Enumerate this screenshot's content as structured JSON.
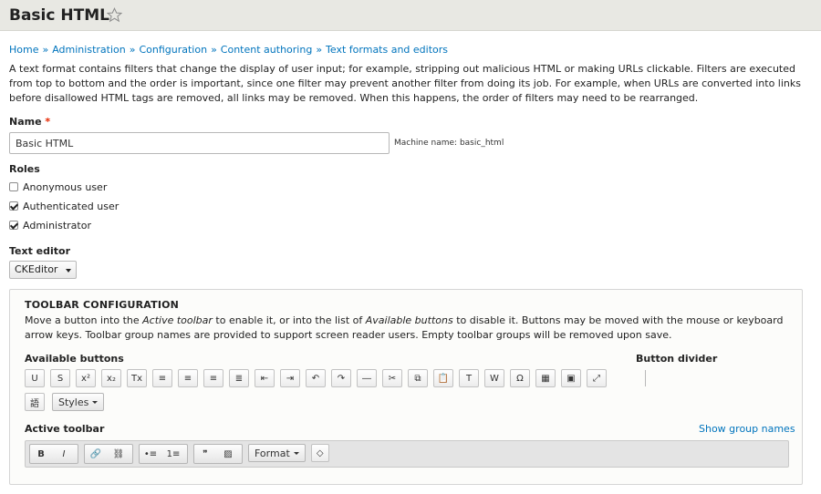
{
  "header": {
    "title": "Basic HTML",
    "star_icon": "star-outline-icon"
  },
  "breadcrumb": [
    "Home",
    "Administration",
    "Configuration",
    "Content authoring",
    "Text formats and editors"
  ],
  "breadcrumb_sep": "»",
  "description": "A text format contains filters that change the display of user input; for example, stripping out malicious HTML or making URLs clickable. Filters are executed from top to bottom and the order is important, since one filter may prevent another filter from doing its job. For example, when URLs are converted into links before disallowed HTML tags are removed, all links may be removed. When this happens, the order of filters may need to be rearranged.",
  "name": {
    "label": "Name",
    "required_mark": "*",
    "value": "Basic HTML",
    "machine_name": "Machine name: basic_html"
  },
  "roles": {
    "label": "Roles",
    "items": [
      {
        "label": "Anonymous user",
        "checked": false
      },
      {
        "label": "Authenticated user",
        "checked": true
      },
      {
        "label": "Administrator",
        "checked": true
      }
    ]
  },
  "text_editor": {
    "label": "Text editor",
    "value": "CKEditor"
  },
  "toolbar": {
    "title": "TOOLBAR CONFIGURATION",
    "description_prefix": "Move a button into the ",
    "description_em1": "Active toolbar",
    "description_mid": " to enable it, or into the list of ",
    "description_em2": "Available buttons",
    "description_suffix": " to disable it. Buttons may be moved with the mouse or keyboard arrow keys. Toolbar group names are provided to support screen reader users. Empty toolbar groups will be removed upon save.",
    "available_label": "Available buttons",
    "divider_label": "Button divider",
    "active_label": "Active toolbar",
    "show_group_names": "Show group names",
    "available_buttons": [
      {
        "glyph": "U",
        "icon": "underline-icon"
      },
      {
        "glyph": "S",
        "icon": "strikethrough-icon"
      },
      {
        "glyph": "x²",
        "icon": "superscript-icon"
      },
      {
        "glyph": "x₂",
        "icon": "subscript-icon"
      },
      {
        "glyph": "Tx",
        "icon": "remove-format-icon"
      },
      {
        "glyph": "≡",
        "icon": "align-left-icon"
      },
      {
        "glyph": "≡",
        "icon": "align-center-icon"
      },
      {
        "glyph": "≡",
        "icon": "align-right-icon"
      },
      {
        "glyph": "≣",
        "icon": "align-justify-icon"
      },
      {
        "glyph": "⇤",
        "icon": "outdent-icon"
      },
      {
        "glyph": "⇥",
        "icon": "indent-icon"
      },
      {
        "glyph": "↶",
        "icon": "undo-icon"
      },
      {
        "glyph": "↷",
        "icon": "redo-icon"
      },
      {
        "glyph": "―",
        "icon": "horizontal-rule-icon"
      },
      {
        "glyph": "✂",
        "icon": "cut-icon"
      },
      {
        "glyph": "⧉",
        "icon": "copy-icon"
      },
      {
        "glyph": "📋",
        "icon": "paste-icon"
      },
      {
        "glyph": "T",
        "icon": "paste-text-icon"
      },
      {
        "glyph": "W",
        "icon": "paste-word-icon"
      },
      {
        "glyph": "Ω",
        "icon": "special-char-icon"
      },
      {
        "glyph": "▦",
        "icon": "table-icon"
      },
      {
        "glyph": "▣",
        "icon": "show-blocks-icon"
      },
      {
        "glyph": "⤢",
        "icon": "maximize-icon"
      }
    ],
    "available_row2": [
      {
        "glyph": "語",
        "icon": "language-icon"
      }
    ],
    "styles_dropdown": "Styles",
    "active_groups": [
      [
        {
          "glyph": "B",
          "icon": "bold-icon"
        },
        {
          "glyph": "I",
          "icon": "italic-icon"
        }
      ],
      [
        {
          "glyph": "🔗",
          "icon": "link-icon"
        },
        {
          "glyph": "⛓",
          "icon": "unlink-icon"
        }
      ],
      [
        {
          "glyph": "•≡",
          "icon": "bulleted-list-icon"
        },
        {
          "glyph": "1≡",
          "icon": "numbered-list-icon"
        }
      ],
      [
        {
          "glyph": "❞",
          "icon": "blockquote-icon"
        },
        {
          "glyph": "▨",
          "icon": "image-icon"
        }
      ]
    ],
    "format_dropdown": "Format",
    "source_icon": {
      "glyph": "◇",
      "icon": "source-icon"
    }
  }
}
